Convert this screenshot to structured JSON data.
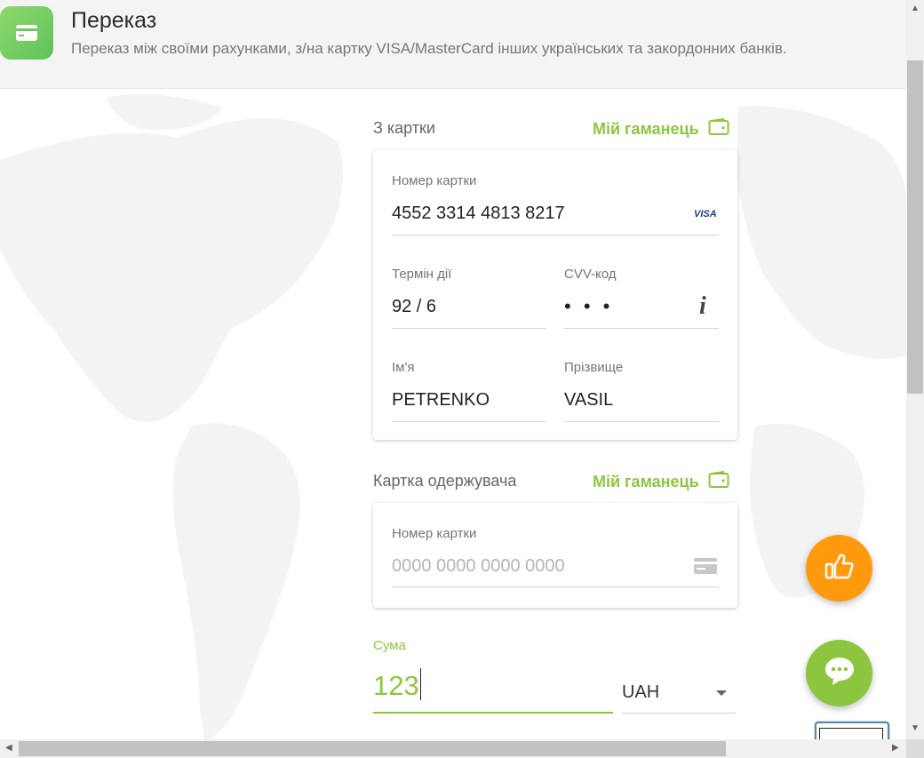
{
  "header": {
    "title": "Переказ",
    "subtitle": "Переказ між своїми рахунками, з/на картку VISA/MasterCard інших українських та закордонних банків."
  },
  "from_card": {
    "section_label": "З картки",
    "wallet_link": "Мій гаманець",
    "card_number_label": "Номер картки",
    "card_number_value": "4552 3314 4813 8217",
    "card_brand": "VISA",
    "expiry_label": "Термін дії",
    "expiry_value": "92 / 6",
    "cvv_label": "CVV-код",
    "cvv_value": "• • •",
    "cvv_info_icon": "info-icon",
    "first_name_label": "Ім'я",
    "first_name_value": "PETRENKO",
    "last_name_label": "Прізвище",
    "last_name_value": "VASIL"
  },
  "to_card": {
    "section_label": "Картка одержувача",
    "wallet_link": "Мій гаманець",
    "card_number_label": "Номер картки",
    "card_number_placeholder": "0000 0000 0000 0000",
    "card_icon": "credit-card-icon"
  },
  "amount": {
    "label": "Сума",
    "value": "123",
    "currency": "UAH"
  },
  "fabs": {
    "like_icon": "thumbs-up-icon",
    "chat_icon": "chat-bubble-icon"
  },
  "colors": {
    "accent_green": "#8cc63f",
    "fab_orange": "#ff9a0e",
    "fab_green": "#8cc63f"
  }
}
